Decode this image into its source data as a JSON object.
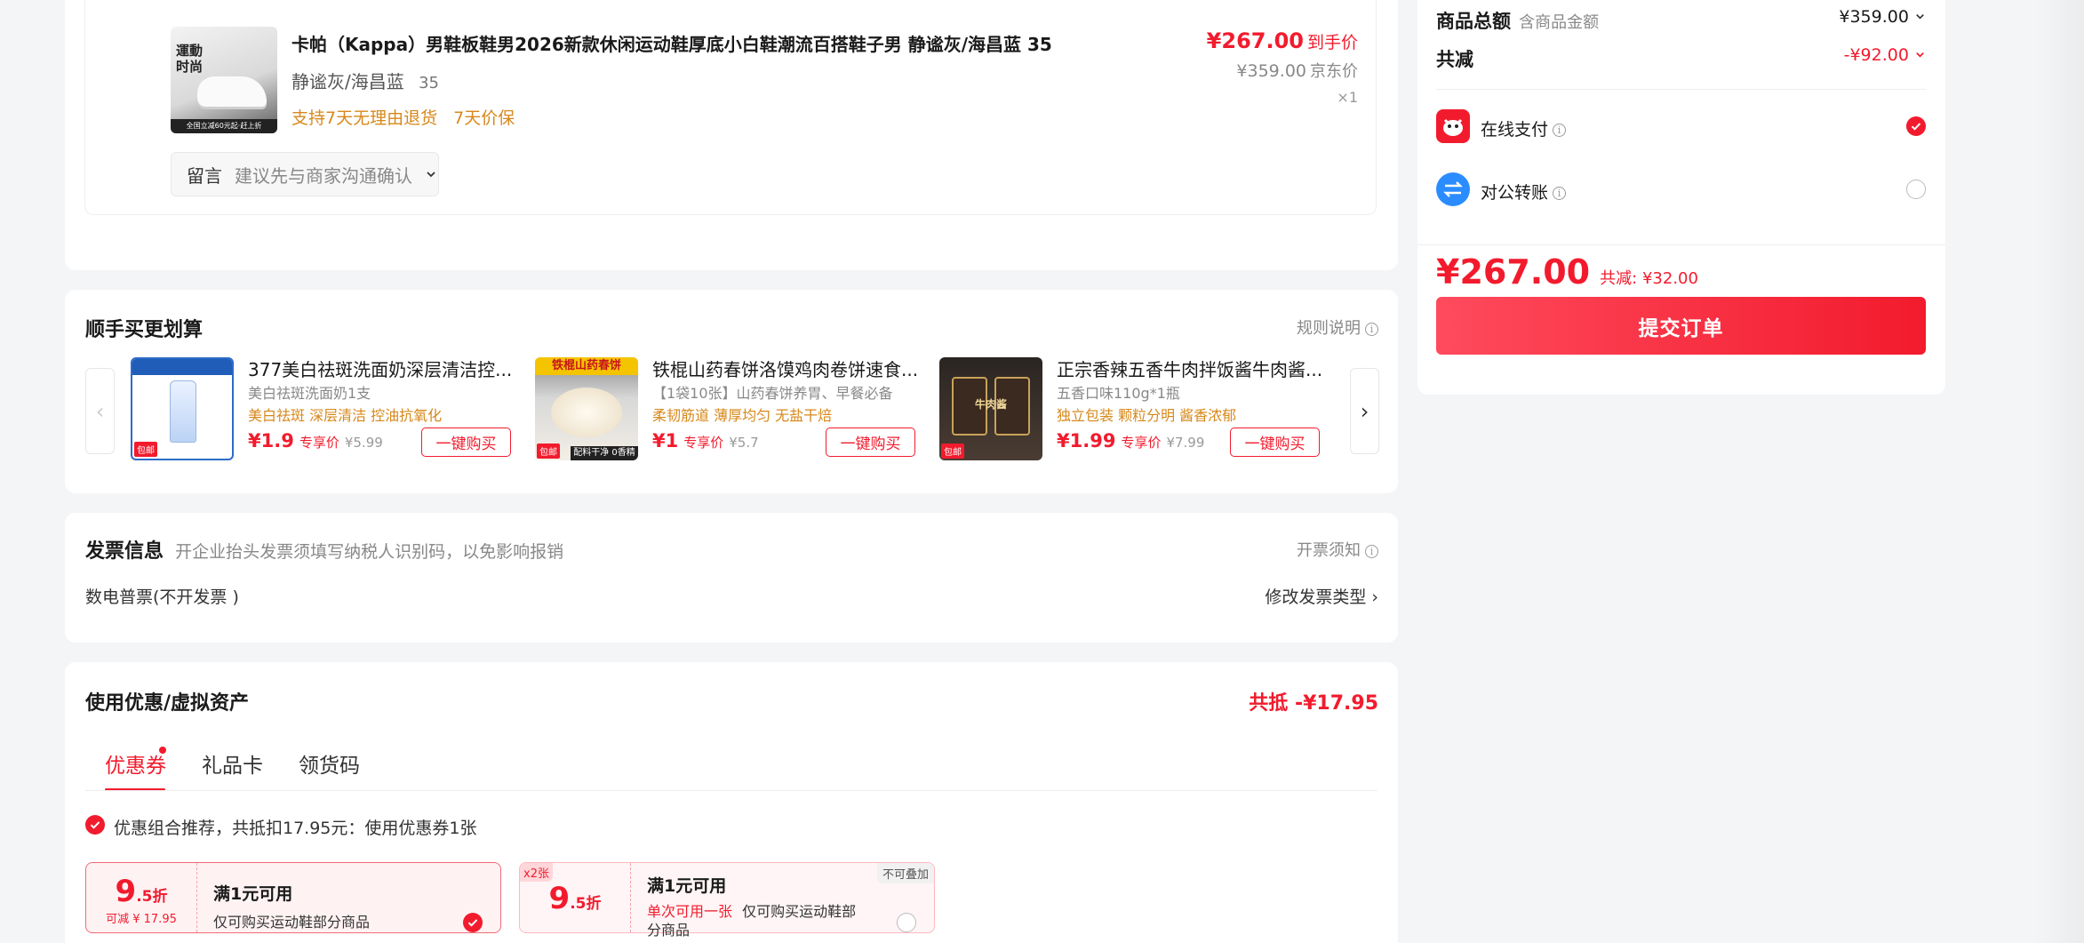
{
  "product": {
    "title": "卡帕（Kappa）男鞋板鞋男2026新款休闲运动鞋厚底小白鞋潮流百搭鞋子男 静谧灰/海昌蓝 35",
    "spec": "静谧灰/海昌蓝",
    "size": "35",
    "service_1": "支持7天无理由退货",
    "service_2": "7天价保",
    "final_price": "¥267.00",
    "final_label": "到手价",
    "jd_price": "¥359.00",
    "jd_label": "京东价",
    "qty": "×1",
    "thumb_text_1": "運動",
    "thumb_text_2": "时尚",
    "thumb_banner": "全国立减60元起·赶上折",
    "remark_label": "留言",
    "remark_placeholder": "建议先与商家沟通确认"
  },
  "bundle": {
    "title": "顺手买更划算",
    "rules": "规则说明",
    "prev_icon": "‹",
    "next_icon": "›",
    "items": [
      {
        "name": "377美白祛斑洗面奶深层清洁控...",
        "sub": "美白祛斑洗面奶1支",
        "tags": "美白祛斑  深层清洁  控油抗氧化",
        "price": "¥1.9",
        "exclusive": "专享价",
        "orig": "¥5.99",
        "buy": "一键购买",
        "badge": "包邮"
      },
      {
        "name": "铁棍山药春饼洛馍鸡肉卷饼速食...",
        "sub": "【1袋10张】山药春饼养胃、早餐必备",
        "tags": "柔韧筋道  薄厚均匀  无盐干焙",
        "price": "¥1",
        "exclusive": "专享价",
        "orig": "¥5.7",
        "buy": "一键购买",
        "badge": "包邮",
        "img_text": "铁棍山药春饼",
        "img_text2": "配料干净 0香精"
      },
      {
        "name": "正宗香辣五香牛肉拌饭酱牛肉酱...",
        "sub": "五香口味110g*1瓶",
        "tags": "独立包装  颗粒分明  酱香浓郁",
        "price": "¥1.99",
        "exclusive": "专享价",
        "orig": "¥7.99",
        "buy": "一键购买",
        "badge": "包邮",
        "img_text": "牛肉酱"
      }
    ]
  },
  "invoice": {
    "title": "发票信息",
    "hint": "开企业抬头发票须填写纳税人识别码，以免影响报销",
    "notice": "开票须知",
    "type": "数电普票(不开发票 )",
    "modify": "修改发票类型 ›"
  },
  "coupon": {
    "title": "使用优惠/虚拟资产",
    "total_label": "共抵",
    "total_value": "-¥17.95",
    "tabs": [
      "优惠券",
      "礼品卡",
      "领货码"
    ],
    "recommend": "优惠组合推荐，共抵扣17.95元：使用优惠券1张",
    "cards": [
      {
        "discount_main": "9",
        "discount_dec": ".5折",
        "save": "可减 ¥ 17.95",
        "title": "满1元可用",
        "desc": "仅可购买运动鞋部分商品"
      },
      {
        "discount_main": "9",
        "discount_dec": ".5折",
        "count": "x2张",
        "tag": "不可叠加",
        "title": "满1元可用",
        "limit": "单次可用一张",
        "desc": "仅可购买运动鞋部分商品"
      }
    ]
  },
  "summary": {
    "total_label": "商品总额",
    "total_sub": "含商品金额",
    "total_value": "¥359.00",
    "reduce_label": "共减",
    "reduce_value": "-¥92.00",
    "pay_online": "在线支付",
    "pay_transfer": "对公转账",
    "pay_price": "¥267.00",
    "pay_save": "共减: ¥32.00",
    "submit": "提交订单"
  },
  "colors": {
    "accent": "#f21b2d",
    "orange": "#d7881b",
    "transfer_blue": "#2a8cff"
  }
}
